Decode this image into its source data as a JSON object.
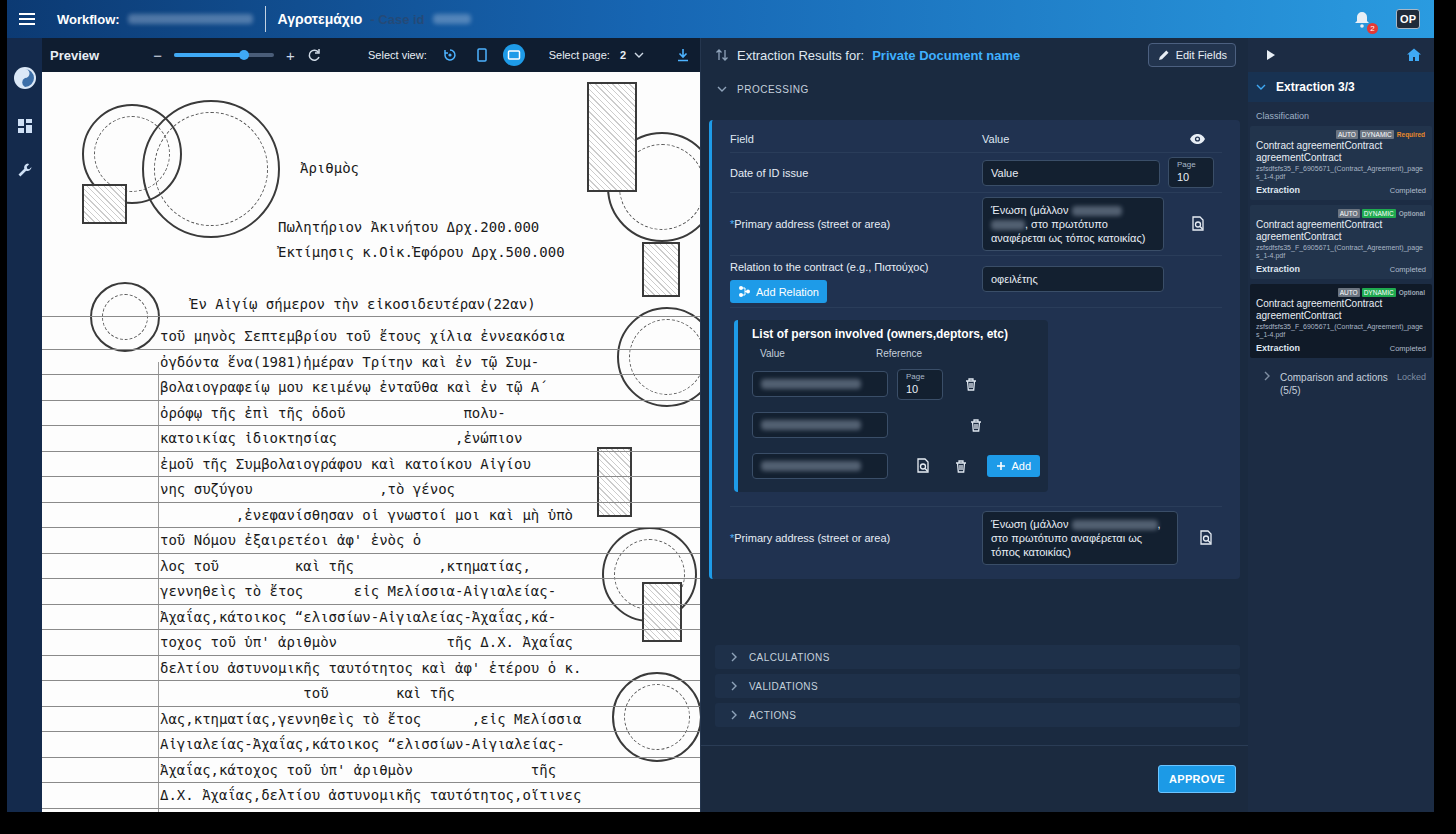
{
  "topbar": {
    "workflow_label": "Workflow:",
    "title": "Αγροτεμάχιο",
    "case_label": "- Case id",
    "notification_count": "2",
    "avatar": "OP"
  },
  "preview": {
    "title": "Preview",
    "zoom_out": "−",
    "zoom_in": "+",
    "zoom_level": 0.7,
    "view_label": "Select view:",
    "views": [
      {
        "selected": false
      },
      {
        "selected": false
      },
      {
        "selected": true
      }
    ],
    "page_label": "Select page:",
    "page": "2",
    "document": {
      "lines": [
        "Ἀριθμὸς",
        "Πωλητήριον Ἀκινήτου Δρχ.200.000",
        "Ἐκτίμησις κ.Οἰκ.Ἐφόρου Δρχ.500.000",
        "Ἐν Αἰγίῳ σήμερον τὴν εἰκοσιδευτέραν(22αν)",
        "τοῦ μηνὸς Σεπτεμβρίου τοῦ ἔτους χίλια ἐννεακόσια",
        "ὀγδόντα ἕνα(1981)ἡμέραν Τρίτην καὶ ἐν τῷ Συμ-",
        "βολαιογραφείῳ μου κειμένῳ ἐνταῦθα καὶ ἐν τῷ Α΄",
        "ὀρόφῳ τῆς ἐπὶ τῆς ὁδοῦ              πολυ-",
        "κατοικίας ἰδιοκτησίας              ,ἐνώπιον",
        "ἐμοῦ τῆς Συμβολαιογράφου καὶ κατοίκου Αἰγίου",
        "νης συζύγου               ,τὸ γένος",
        "         ,ἐνεφανίσθησαν οἱ γνωστοί μοι καὶ μὴ ὑπὸ",
        "τοῦ Νόμου ἐξαιρετέοι ἀφ' ἑνὸς ὁ",
        "λος τοῦ         καὶ τῆς          ,κτηματίας,",
        "γεννηθεὶς τὸ ἔτος      εἰς Μελίσσια-Αἰγιαλείας-",
        "Ἀχαΐας,κάτοικος “ελισσίων-Αἰγιαλείας-Ἀχαΐας,κά-",
        "τοχος τοῦ ὑπ' ἀριθμὸν             τῆς Δ.Χ. Ἀχαΐας",
        "δελτίου ἀστυνομικῆς ταυτότητος καὶ ἀφ' ἑτέρου ὁ κ.",
        "                 τοῦ        καὶ τῆς",
        "λας,κτηματίας,γεννηθεὶς τὸ ἔτος      ,εἰς Μελίσσια",
        "Αἰγιαλείας-Ἀχαΐας,κάτοικος “ελισσίων-Αἰγιαλείας-",
        "Ἀχαΐας,κάτοχος τοῦ ὑπ' ἀριθμὸν              τῆς",
        "Δ.Χ. Ἀχαΐας,δελτίου ἀστυνομικῆς ταυτότητος,οἵτινες"
      ]
    }
  },
  "extraction": {
    "title_label": "Extraction Results for:",
    "document_name": "Private Document name",
    "edit_button": "Edit Fields",
    "section": {
      "title": "PROCESSING",
      "expanded": true
    },
    "columns": [
      "Field",
      "Value"
    ],
    "fields": [
      {
        "kind": "date",
        "label": "Date of ID issue",
        "value": "Value",
        "page_label": "Page",
        "page": "10"
      },
      {
        "kind": "address",
        "required_marker": "*",
        "label": "Primary address (street or area)",
        "value_parts": [
          "Ένωση (μάλλον ",
          ", στο πρωτότυπο αναφέρεται ως τόπος κατοικίας)"
        ]
      },
      {
        "kind": "relation",
        "label": "Relation to the contract (e.g., Πιστούχος)",
        "button": "Add Relation",
        "value": "οφειλέτης"
      },
      {
        "kind": "list",
        "title": "List of person involved (owners,deptors, etc)",
        "columns": [
          "Value",
          "Reference"
        ],
        "rows": [
          {
            "kind": "page",
            "page_label": "Page",
            "page": "10"
          },
          {
            "kind": "plain"
          },
          {
            "kind": "locate"
          }
        ],
        "add": "Add"
      },
      {
        "kind": "address",
        "required_marker": "*",
        "label": "Primary address (street or area)",
        "value_parts": [
          "Ένωση (μάλλον ",
          ", στο πρωτότυπο αναφέρεται ως τόπος κατοικίας)"
        ]
      }
    ],
    "collapsed": [
      {
        "title": "CALCULATIONS",
        "expanded": false
      },
      {
        "title": "VALIDATIONS",
        "expanded": false
      },
      {
        "title": "ACTIONS",
        "expanded": false
      }
    ],
    "approve": "APPROVE"
  },
  "steps": {
    "title": "Extraction 3/3",
    "expanded": true,
    "group": "Classification",
    "cards": [
      {
        "tags": [
          {
            "label": "AUTO",
            "kind": "badge",
            "color": "#6b7480"
          },
          {
            "label": "DYNAMIC",
            "kind": "badge",
            "color": "#6b7480"
          },
          {
            "label": "Required",
            "kind": "label",
            "color": "#e8892b"
          }
        ],
        "title": "Contract agreementContract agreementContract",
        "file": "zsfsdfsfs35_F_6905671_(Contract_Agreement)_pages_1-4.pdf",
        "step": "Extraction",
        "status": "Completed",
        "selected": false
      },
      {
        "tags": [
          {
            "label": "AUTO",
            "kind": "badge",
            "color": "#6b7480"
          },
          {
            "label": "DYNAMIC",
            "kind": "badge",
            "color": "#1faa4f"
          },
          {
            "label": "Optional",
            "kind": "label",
            "color": "#9aa6b4"
          }
        ],
        "title": "Contract agreementContract agreementContract",
        "file": "zsfsdfsfs35_F_6905671_(Contract_Agreement)_pages_1-4.pdf",
        "step": "Extraction",
        "status": "Completed",
        "selected": false
      },
      {
        "tags": [
          {
            "label": "AUTO",
            "kind": "badge",
            "color": "#6b7480"
          },
          {
            "label": "DYNAMIC",
            "kind": "badge",
            "color": "#1faa4f"
          },
          {
            "label": "Optional",
            "kind": "label",
            "color": "#9aa6b4"
          }
        ],
        "title": "Contract agreementContract agreementContract",
        "file": "zsfsdfsfs35_F_6905671_(Contract_Agreement)_pages_1-4.pdf",
        "step": "Extraction",
        "status": "Completed",
        "selected": true
      }
    ],
    "next": {
      "title": "Comparison and actions (5/5)",
      "status": "Locked",
      "expanded": false
    }
  }
}
